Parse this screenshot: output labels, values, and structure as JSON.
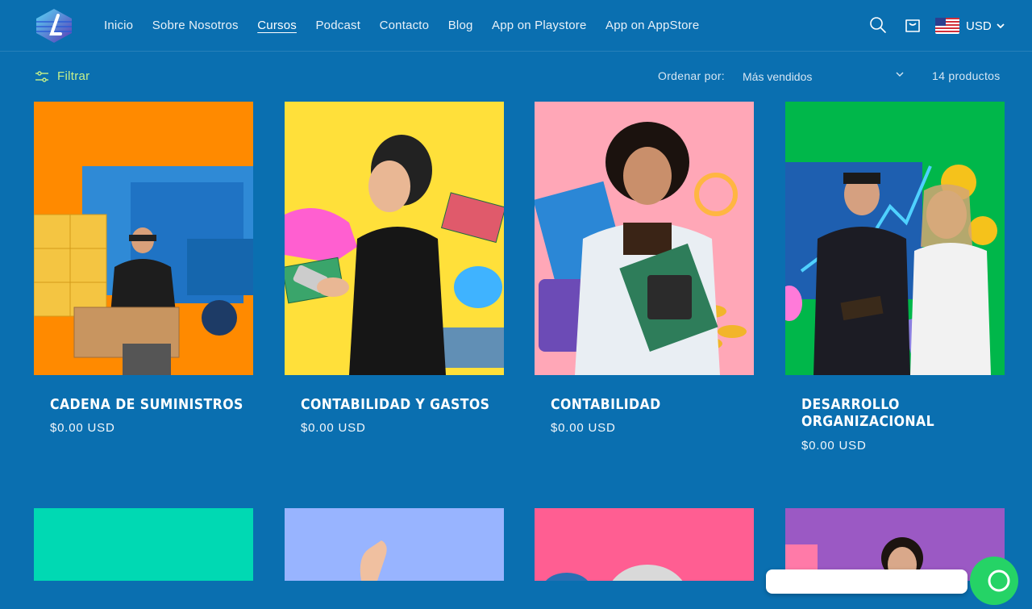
{
  "header": {
    "nav": [
      "Inicio",
      "Sobre Nosotros",
      "Cursos",
      "Podcast",
      "Contacto",
      "Blog",
      "App on Playstore",
      "App on AppStore"
    ],
    "active_nav": "Cursos",
    "currency": "USD"
  },
  "toolbar": {
    "filter_label": "Filtrar",
    "sort_label": "Ordenar por:",
    "sort_value": "Más vendidos",
    "count": "14 productos"
  },
  "products": [
    {
      "title": "CADENA DE SUMINISTROS",
      "price": "$0.00 USD",
      "bg": "#ff8a00"
    },
    {
      "title": "CONTABILIDAD Y GASTOS",
      "price": "$0.00 USD",
      "bg": "#ffe03a"
    },
    {
      "title": "CONTABILIDAD",
      "price": "$0.00 USD",
      "bg": "#ffa7b7"
    },
    {
      "title": "DESARROLLO ORGANIZACIONAL",
      "price": "$0.00 USD",
      "bg": "#00b74a"
    }
  ],
  "next_row_colors": [
    "#00d9b3",
    "#98b4ff",
    "#ff5e92",
    "#9b59c4"
  ],
  "colors": {
    "page_bg": "#0a6fb0",
    "filter_accent": "#c6f08a",
    "whatsapp": "#25d366"
  }
}
